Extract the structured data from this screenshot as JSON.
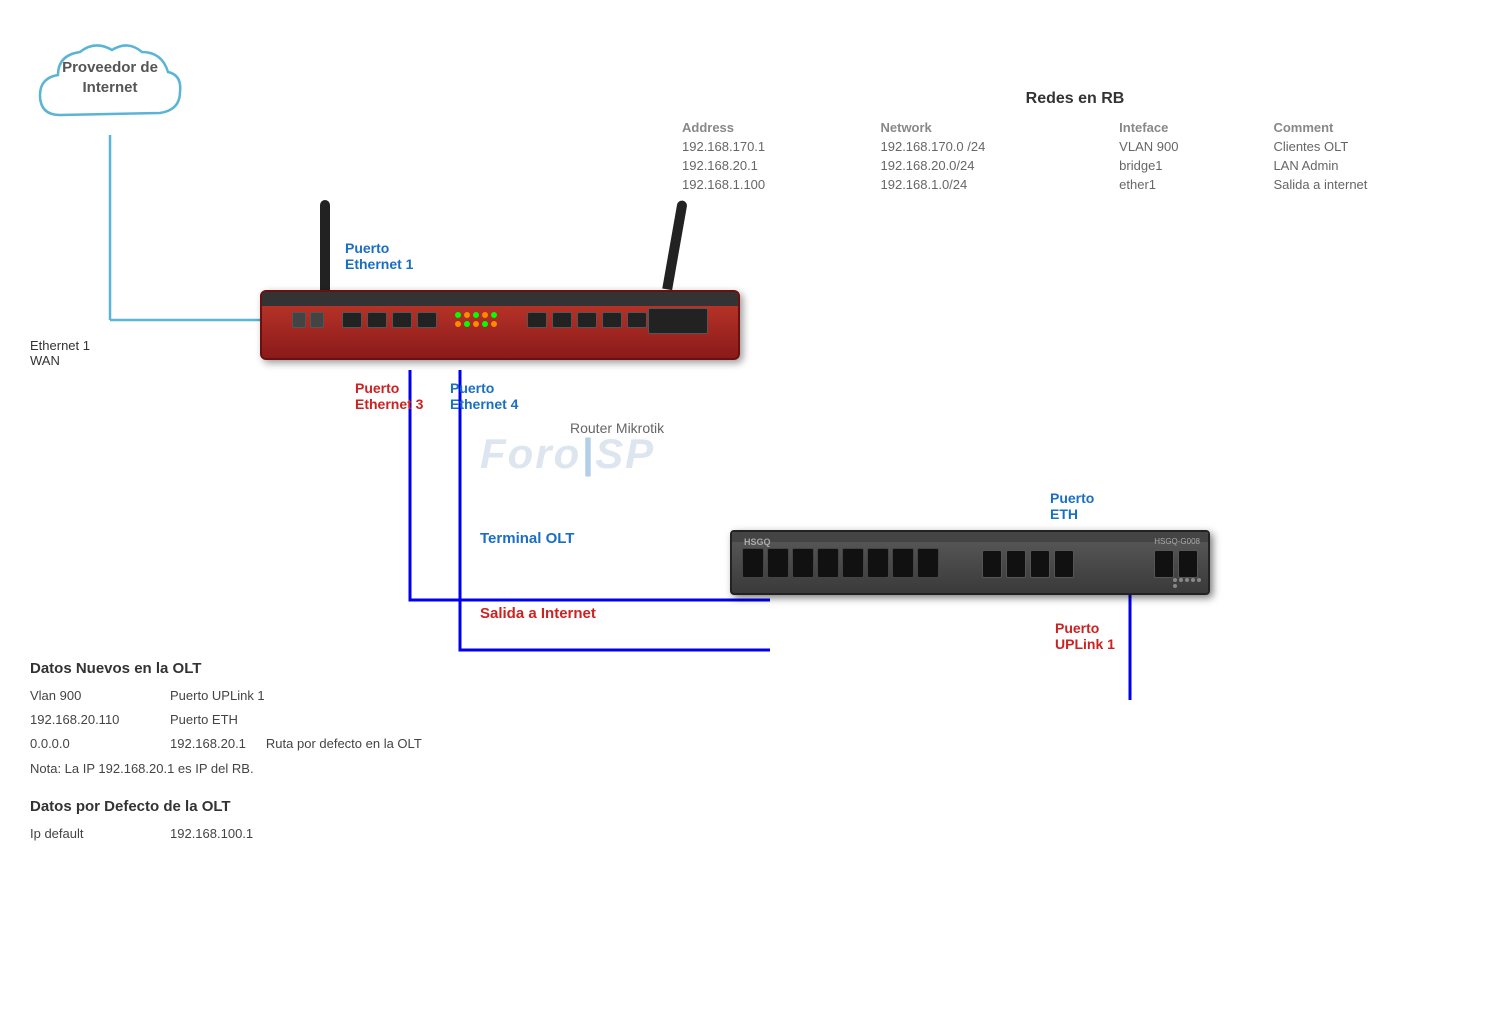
{
  "cloud": {
    "label_line1": "Proveedor de",
    "label_line2": "Internet"
  },
  "redes": {
    "title": "Redes en RB",
    "headers": [
      "Address",
      "Network",
      "Inteface",
      "Comment"
    ],
    "rows": [
      [
        "192.168.170.1",
        "192.168.170.0 /24",
        "VLAN 900",
        "Clientes OLT"
      ],
      [
        "192.168.20.1",
        "192.168.20.0/24",
        "bridge1",
        "LAN Admin"
      ],
      [
        "192.168.1.100",
        "192.168.1.0/24",
        "ether1",
        "Salida a internet"
      ]
    ]
  },
  "labels": {
    "ethernet1_wan_line1": "Ethernet 1",
    "ethernet1_wan_line2": "WAN",
    "puerto_eth1_line1": "Puerto",
    "puerto_eth1_line2": "Ethernet 1",
    "puerto_eth3_line1": "Puerto",
    "puerto_eth3_line2": "Ethernet 3",
    "puerto_eth4_line1": "Puerto",
    "puerto_eth4_line2": "Ethernet 4",
    "router_label": "Router Mikrotik",
    "terminal_olt": "Terminal OLT",
    "salida_internet": "Salida a Internet",
    "puerto_eth_line1": "Puerto",
    "puerto_eth_line2": "ETH",
    "puerto_uplink_line1": "Puerto",
    "puerto_uplink_line2": "UPLink 1"
  },
  "datos_nuevos": {
    "title": "Datos Nuevos en  la OLT",
    "rows": [
      {
        "key": "Vlan 900",
        "val": "Puerto UPLink 1",
        "extra": ""
      },
      {
        "key": "192.168.20.110",
        "val": "Puerto ETH",
        "extra": ""
      },
      {
        "key": "0.0.0.0",
        "val": "192.168.20.1",
        "extra": "Ruta  por defecto en la OLT"
      }
    ],
    "note": "Nota: La IP 192.168.20.1 es IP del RB."
  },
  "datos_defecto": {
    "title": "Datos por Defecto de la OLT",
    "rows": [
      {
        "key": "Ip default",
        "val": "192.168.100.1"
      }
    ]
  },
  "watermark": "ForoISP"
}
